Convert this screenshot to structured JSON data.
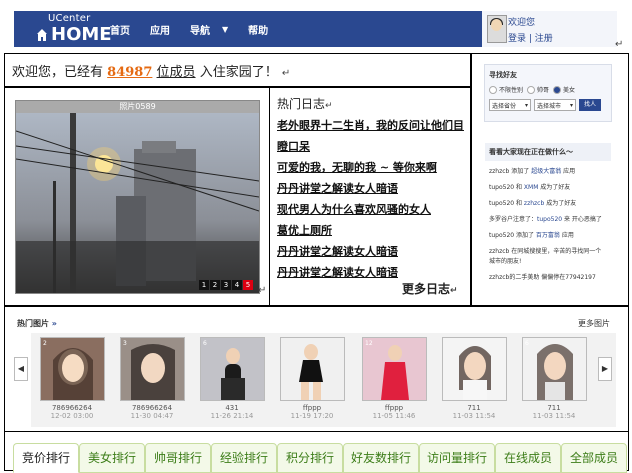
{
  "header": {
    "brand_top": "UCenter",
    "brand_bottom": "HOME",
    "nav": [
      "首页",
      "应用",
      "导航",
      "帮助"
    ],
    "welcome": "欢迎您",
    "login": "登录",
    "register": "注册"
  },
  "welcome_line": {
    "prefix": "欢迎您，已经有",
    "count": "84987",
    "suffix": "位成员",
    "tail": "入住家园了！"
  },
  "photo": {
    "title": "照片0589",
    "pager": [
      "1",
      "2",
      "3",
      "4",
      "5"
    ],
    "active_page": "5"
  },
  "hot_diaries": {
    "title": "热门日志",
    "items": [
      "老外眼界十二生肖，我的反问让他们目瞪口呆",
      "可爱的我，无聊的我 ~ 等你来啊",
      "丹丹讲堂之解读女人暗语",
      "现代男人为什么喜欢风骚的女人",
      "葛优上厕所",
      "丹丹讲堂之解读女人暗语",
      "丹丹讲堂之解读女人暗语"
    ],
    "more": "更多日志"
  },
  "sidebar": {
    "find_friends": {
      "title": "寻找好友",
      "genders": [
        "不限性别",
        "帅哥",
        "美女"
      ],
      "province": "选择省份",
      "city": "选择城市",
      "button": "找人"
    },
    "activity": {
      "title": "看看大家现在正在做什么～",
      "items": [
        {
          "user": "zzhzcb",
          "text1": " 添加了 ",
          "target": "超级大富翁",
          "text2": " 应用"
        },
        {
          "user": "tupo520",
          "text1": " 和 ",
          "target": "XMM",
          "text2": " 成为了好友"
        },
        {
          "user": "tupo520",
          "text1": " 和 ",
          "target": "zzhzcb",
          "text2": " 成为了好友"
        },
        {
          "user": "",
          "text1": "多罗谷户注意了：",
          "target": "tupo520",
          "text2": " 来 开心恶搞了"
        },
        {
          "user": "tupo520",
          "text1": " 添加了 ",
          "target": "百万富翁",
          "text2": " 应用"
        },
        {
          "user": "zzhzcb",
          "text1": " 在同城搜搜里，辛苦的寻找同一个城市的朋友!",
          "target": "",
          "text2": ""
        },
        {
          "user": "zzhzcb",
          "text1": "的二手美助 偏偏停在77942197",
          "target": "",
          "text2": ""
        }
      ]
    }
  },
  "hot_pictures": {
    "title": "热门图片",
    "title_arrow": "»",
    "more": "更多图片",
    "items": [
      {
        "num": "2",
        "user": "786966264",
        "time": "12-02 03:00"
      },
      {
        "num": "3",
        "user": "786966264",
        "time": "11-30 04:47"
      },
      {
        "num": "6",
        "user": "431",
        "time": "11-26 21:14"
      },
      {
        "num": "",
        "user": "ffppp",
        "time": "11-19 17:20"
      },
      {
        "num": "12",
        "user": "ffppp",
        "time": "11-05 11:46"
      },
      {
        "num": "",
        "user": "711",
        "time": "11-03 11:54"
      },
      {
        "num": "6",
        "user": "711",
        "time": "11-03 11:54"
      }
    ]
  },
  "tabs": [
    "竞价排行",
    "美女排行",
    "帅哥排行",
    "经验排行",
    "积分排行",
    "好友数排行",
    "访问量排行",
    "在线成员",
    "全部成员"
  ],
  "colors": {
    "header_blue": "#2a4890",
    "count_orange": "#e56a12",
    "tab_green": "#3c7d18"
  }
}
